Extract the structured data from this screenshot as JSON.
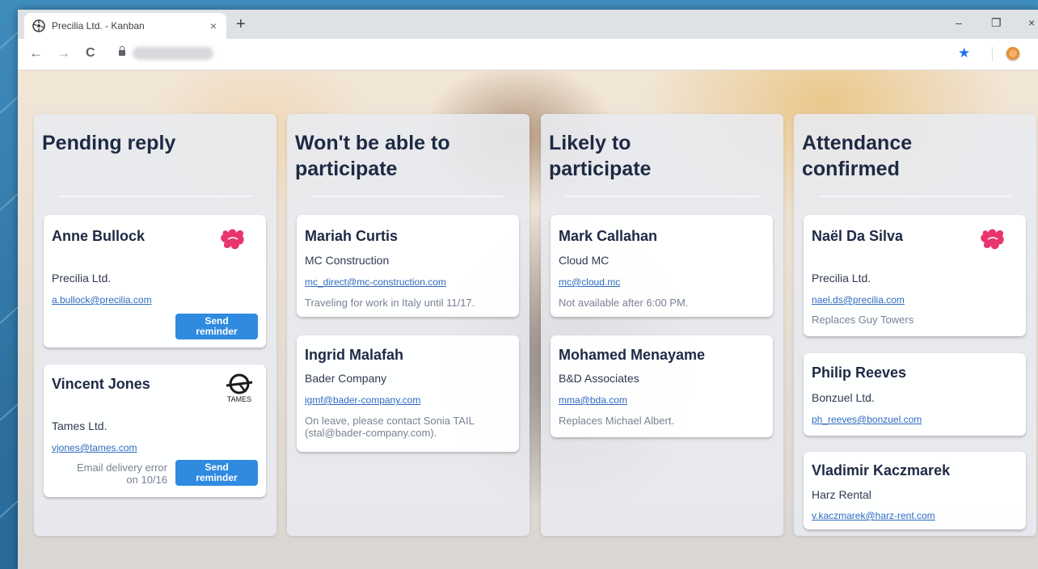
{
  "browser": {
    "tab_title": "Precilia Ltd. - Kanban",
    "close_glyph": "×",
    "new_tab_glyph": "+",
    "minimize_glyph": "–",
    "restore_glyph": "❐",
    "close_window_glyph": "×",
    "back_glyph": "←",
    "forward_glyph": "→",
    "reload_glyph": "C",
    "star_glyph": "★"
  },
  "columns": [
    {
      "title": "Pending reply",
      "cards": [
        {
          "name": "Anne Bullock",
          "company": "Precilia Ltd.",
          "email": "a.bullock@precilia.com",
          "button_line1": "Send",
          "button_line2": "reminder",
          "logo": "precilia-logo"
        },
        {
          "name": "Vincent Jones",
          "company": "Tames Ltd.",
          "email": "vjones@tames.com",
          "error_line1": "Email delivery error",
          "error_line2": "on 10/16",
          "button_line1": "Send",
          "button_line2": "reminder",
          "logo": "tames-logo",
          "logo_text": "TAMES"
        }
      ]
    },
    {
      "title": "Won't be able to participate",
      "cards": [
        {
          "name": "Mariah Curtis",
          "company": "MC Construction",
          "email": "mc_direct@mc-construction.com",
          "note": "Traveling for work in Italy until 11/17."
        },
        {
          "name": "Ingrid Malafah",
          "company": "Bader Company",
          "email": "igmf@bader-company.com",
          "note": "On leave, please contact Sonia TAIL (stal@bader-company.com)."
        }
      ]
    },
    {
      "title": "Likely to participate",
      "cards": [
        {
          "name": "Mark Callahan",
          "company": "Cloud MC",
          "email": "mc@cloud.mc",
          "note": "Not available after 6:00 PM."
        },
        {
          "name": "Mohamed Menayame",
          "company": "B&D Associates",
          "email": "mma@bda.com",
          "note": "Replaces Michael Albert."
        }
      ]
    },
    {
      "title": "Attendance confirmed",
      "cards": [
        {
          "name": "Naël Da Silva",
          "company": "Precilia Ltd.",
          "email": "nael.ds@precilia.com",
          "note": "Replaces Guy Towers",
          "logo": "precilia-logo"
        },
        {
          "name": "Philip Reeves",
          "company": "Bonzuel Ltd.",
          "email": "ph_reeves@bonzuel.com"
        },
        {
          "name": "Vladimir Kaczmarek",
          "company": "Harz Rental",
          "email": "v.kaczmarek@harz-rent.com"
        }
      ]
    }
  ],
  "colors": {
    "button": "#2f8ae0",
    "title": "#1e2a44",
    "link": "#2f6bbf"
  }
}
